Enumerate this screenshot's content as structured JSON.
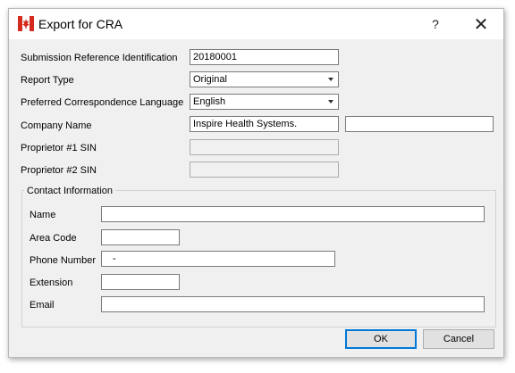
{
  "window": {
    "title": "Export for CRA",
    "help_label": "?",
    "close_label": "✕",
    "icon": "canada-flag-icon",
    "flag_red": "#d52b1e"
  },
  "form": {
    "submission_ref": {
      "label": "Submission Reference Identification",
      "value": "20180001"
    },
    "report_type": {
      "label": "Report Type",
      "value": "Original"
    },
    "language": {
      "label": "Preferred Correspondence Language",
      "value": "English"
    },
    "company_name": {
      "label": "Company Name",
      "value": "Inspire Health Systems.",
      "value2": ""
    },
    "proprietor1_sin": {
      "label": "Proprietor #1 SIN",
      "value": ""
    },
    "proprietor2_sin": {
      "label": "Proprietor #2 SIN",
      "value": ""
    }
  },
  "contact": {
    "group_title": "Contact Information",
    "name": {
      "label": "Name",
      "value": ""
    },
    "area_code": {
      "label": "Area Code",
      "value": ""
    },
    "phone_number": {
      "label": "Phone Number",
      "value": "-"
    },
    "extension": {
      "label": "Extension",
      "value": ""
    },
    "email": {
      "label": "Email",
      "value": ""
    }
  },
  "buttons": {
    "ok_label": "OK",
    "cancel_label": "Cancel",
    "accent": "#0078d7"
  }
}
